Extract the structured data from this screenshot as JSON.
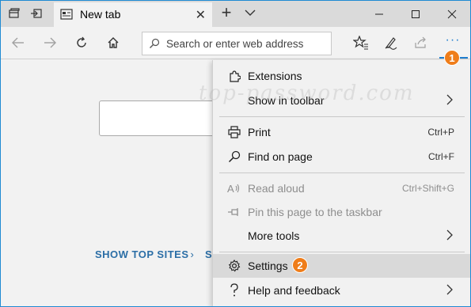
{
  "tab": {
    "title": "New tab",
    "close_glyph": "✕"
  },
  "titlebar": {
    "new_tab_glyph": "+",
    "minimize_glyph": "—",
    "close_glyph": "✕"
  },
  "address": {
    "placeholder": "Search or enter web address"
  },
  "toolbar": {
    "more_glyph": "···"
  },
  "content": {
    "show_top_sites": "SHOW TOP SITES",
    "show_top_sites_chevron": "›",
    "second_link_partial": "S"
  },
  "menu": {
    "items": [
      {
        "label": "Extensions",
        "icon": "puzzle-icon",
        "shortcut": "",
        "disabled": false
      },
      {
        "label": "Show in toolbar",
        "icon": "",
        "shortcut": "",
        "submenu": true,
        "disabled": false
      },
      {
        "label": "Print",
        "icon": "printer-icon",
        "shortcut": "Ctrl+P",
        "disabled": false
      },
      {
        "label": "Find on page",
        "icon": "search-icon",
        "shortcut": "Ctrl+F",
        "disabled": false
      },
      {
        "label": "Read aloud",
        "icon": "read-aloud-icon",
        "shortcut": "Ctrl+Shift+G",
        "disabled": true
      },
      {
        "label": "Pin this page to the taskbar",
        "icon": "pin-icon",
        "shortcut": "",
        "disabled": true
      },
      {
        "label": "More tools",
        "icon": "",
        "shortcut": "",
        "submenu": true,
        "disabled": false
      },
      {
        "label": "Settings",
        "icon": "gear-icon",
        "shortcut": "",
        "disabled": false,
        "selected": true
      },
      {
        "label": "Help and feedback",
        "icon": "help-icon",
        "shortcut": "",
        "submenu": true,
        "disabled": false
      }
    ]
  },
  "badges": {
    "step1": "1",
    "step2": "2"
  },
  "watermark": "top-password.com",
  "colors": {
    "accent": "#1f7ecf",
    "badge": "#ef7d1a",
    "link": "#2b6ea6"
  }
}
